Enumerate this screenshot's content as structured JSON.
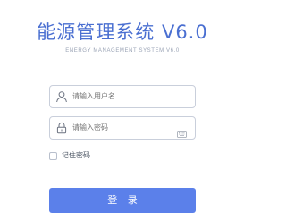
{
  "header": {
    "title": "能源管理系统 V6.0",
    "subtitle": "ENERGY MANAGEMENT SYSTEM V6.0"
  },
  "form": {
    "username": {
      "placeholder": "请输入用户名",
      "icon": "user-icon"
    },
    "password": {
      "placeholder": "请输入密码",
      "icon": "lock-icon",
      "trailing_icon": "keyboard-icon"
    },
    "remember": {
      "label": "记住密码",
      "checked": false
    },
    "submit_label": "登 录"
  },
  "colors": {
    "accent": "#5b80ea",
    "title": "#4a6fd1",
    "border": "#c9cfdb"
  }
}
